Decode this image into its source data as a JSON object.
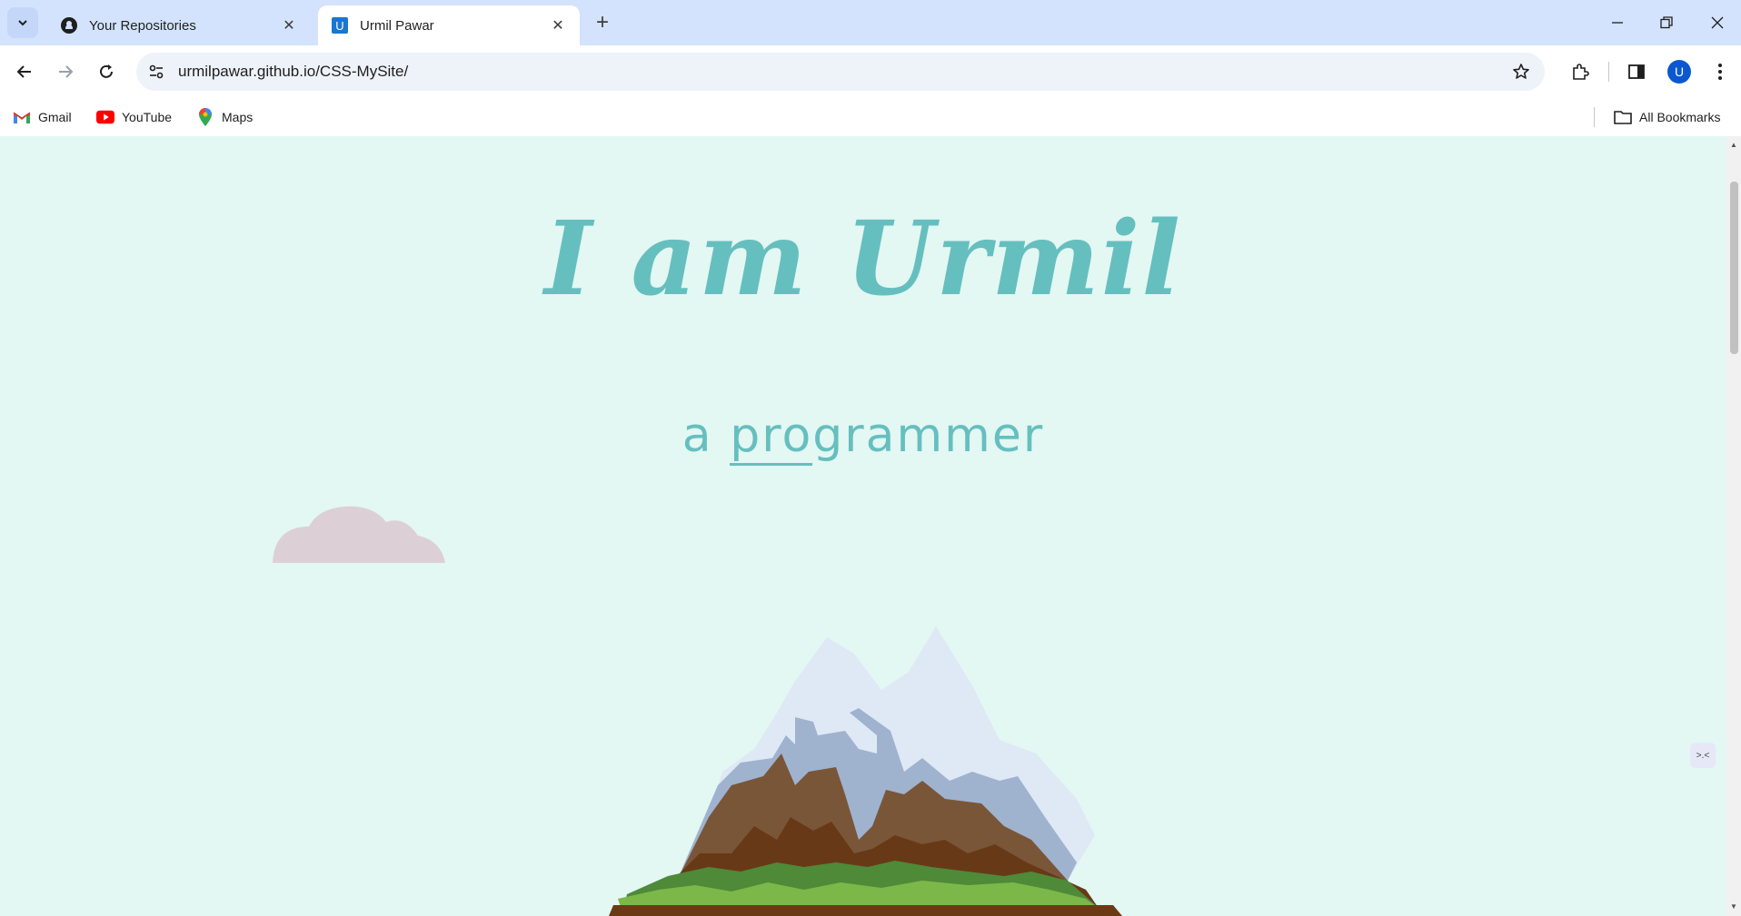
{
  "browser": {
    "tabs": [
      {
        "title": "Your Repositories",
        "icon": "github-icon",
        "active": false
      },
      {
        "title": "Urmil Pawar",
        "icon": "site-favicon-u",
        "active": true
      }
    ],
    "favicon_letter": "U",
    "address": "urmilpawar.github.io/CSS-MySite/",
    "profile_initial": "U",
    "bookmarks": [
      {
        "label": "Gmail",
        "icon": "gmail-icon"
      },
      {
        "label": "YouTube",
        "icon": "youtube-icon"
      },
      {
        "label": "Maps",
        "icon": "maps-icon"
      }
    ],
    "all_bookmarks_label": "All Bookmarks"
  },
  "page": {
    "title": "I am Urmil",
    "subtitle_prefix": "a ",
    "subtitle_underlined": "pro",
    "subtitle_rest": "grammer",
    "widget_label": ">.<",
    "colors": {
      "background": "#e3f7f3",
      "accent": "#66bfbf",
      "cloud": "#dcd0d6"
    }
  }
}
